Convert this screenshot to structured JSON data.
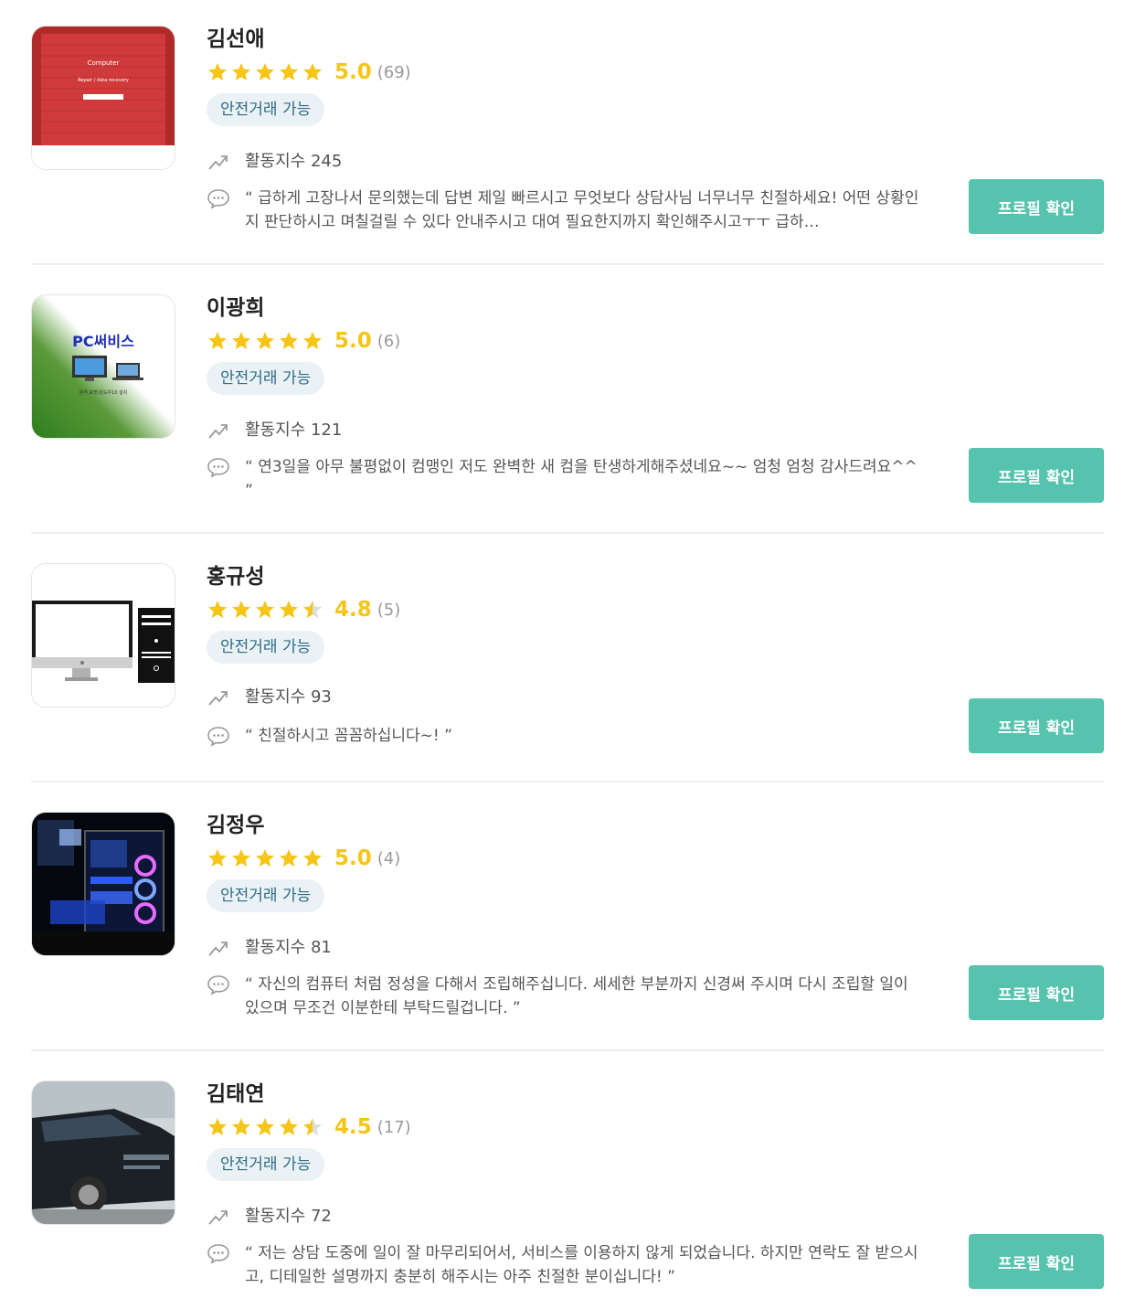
{
  "colors": {
    "accent": "#55c3ad",
    "star": "#f5c518",
    "badge_bg": "#eaf2f5",
    "badge_text": "#2f6c86"
  },
  "icons": {
    "activity": "trending-up-icon",
    "review": "speech-bubble-icon",
    "star": "star-icon"
  },
  "experts": [
    {
      "name": "김선애",
      "rating": 5.0,
      "score": "5.0",
      "count": "(69)",
      "stars": 5,
      "badge": "안전거래 가능",
      "activity": "활동지수 245",
      "review": "“ 급하게 고장나서 문의했는데 답변 제일 빠르시고 무엇보다 상담사님 너무너무 친절하세요! 어떤 상황인지 판단하시고 며칠걸릴 수 있다 안내주시고 대여 필요한지까지 확인해주시고ㅜㅜ 급하…",
      "button": "프로필 확인",
      "thumb_text": [
        "Computer",
        "Repair / data recovery"
      ]
    },
    {
      "name": "이광희",
      "rating": 5.0,
      "score": "5.0",
      "count": "(6)",
      "stars": 5,
      "badge": "안전거래 가능",
      "activity": "활동지수 121",
      "review": "“ 연3일을 아무 불평없이 컴맹인 저도 완벽한 새 컴을 탄생하게해주셨네요~~ 엄청 엄청 감사드려요^^ ”",
      "button": "프로필 확인",
      "thumb_text": [
        "PC써비스",
        "원격 포맷/윈도우10 설치"
      ]
    },
    {
      "name": "홍규성",
      "rating": 4.8,
      "score": "4.8",
      "count": "(5)",
      "stars": 4.5,
      "badge": "안전거래 가능",
      "activity": "활동지수 93",
      "review": "“ 친절하시고 꼼꼼하십니다~! ”",
      "button": "프로필 확인",
      "thumb_text": []
    },
    {
      "name": "김정우",
      "rating": 5.0,
      "score": "5.0",
      "count": "(4)",
      "stars": 5,
      "badge": "안전거래 가능",
      "activity": "활동지수 81",
      "review": "“ 자신의 컴퓨터 처럼 정성을 다해서 조립해주십니다. 세세한 부분까지 신경써 주시며 다시 조립할 일이 있으며 무조건 이분한테 부탁드릴겁니다. ”",
      "button": "프로필 확인",
      "thumb_text": []
    },
    {
      "name": "김태연",
      "rating": 4.5,
      "score": "4.5",
      "count": "(17)",
      "stars": 4.5,
      "badge": "안전거래 가능",
      "activity": "활동지수 72",
      "review": "“ 저는 상담 도중에 일이 잘 마무리되어서, 서비스를 이용하지 않게 되었습니다. 하지만 연락도 잘 받으시고, 디테일한 설명까지 충분히 해주시는 아주 친절한 분이십니다! ”",
      "button": "프로필 확인",
      "thumb_text": []
    }
  ]
}
